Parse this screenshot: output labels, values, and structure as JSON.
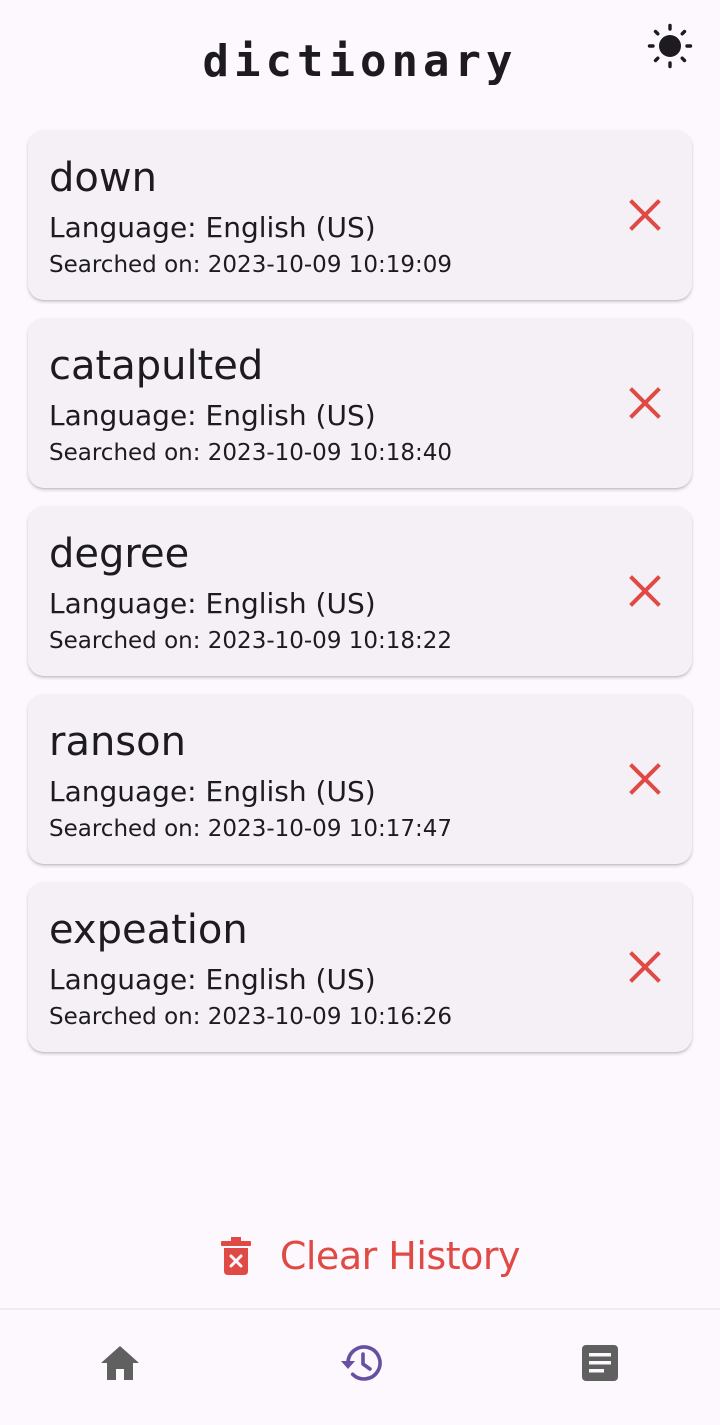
{
  "app": {
    "title": "dictionary"
  },
  "header": {
    "theme_toggle_icon": "sun-icon"
  },
  "history": [
    {
      "word": "down",
      "language": "Language: English (US)",
      "searched": "Searched on: 2023-10-09 10:19:09"
    },
    {
      "word": "catapulted",
      "language": "Language: English (US)",
      "searched": "Searched on: 2023-10-09 10:18:40"
    },
    {
      "word": "degree",
      "language": "Language: English (US)",
      "searched": "Searched on: 2023-10-09 10:18:22"
    },
    {
      "word": "ranson",
      "language": "Language: English (US)",
      "searched": "Searched on: 2023-10-09 10:17:47"
    },
    {
      "word": "expeation",
      "language": "Language: English (US)",
      "searched": "Searched on: 2023-10-09 10:16:26"
    }
  ],
  "clear_history": {
    "label": "Clear History",
    "icon": "trash-icon"
  },
  "bottom_nav": {
    "items": [
      {
        "name": "home",
        "icon": "home-icon",
        "active": false
      },
      {
        "name": "history",
        "icon": "history-icon",
        "active": true
      },
      {
        "name": "notes",
        "icon": "article-icon",
        "active": false
      }
    ]
  },
  "colors": {
    "accent": "#6750a4",
    "danger": "#e04a45",
    "inactive_icon": "#606060",
    "card_background": "#f4f0f6",
    "page_background": "#fdf8fd"
  }
}
